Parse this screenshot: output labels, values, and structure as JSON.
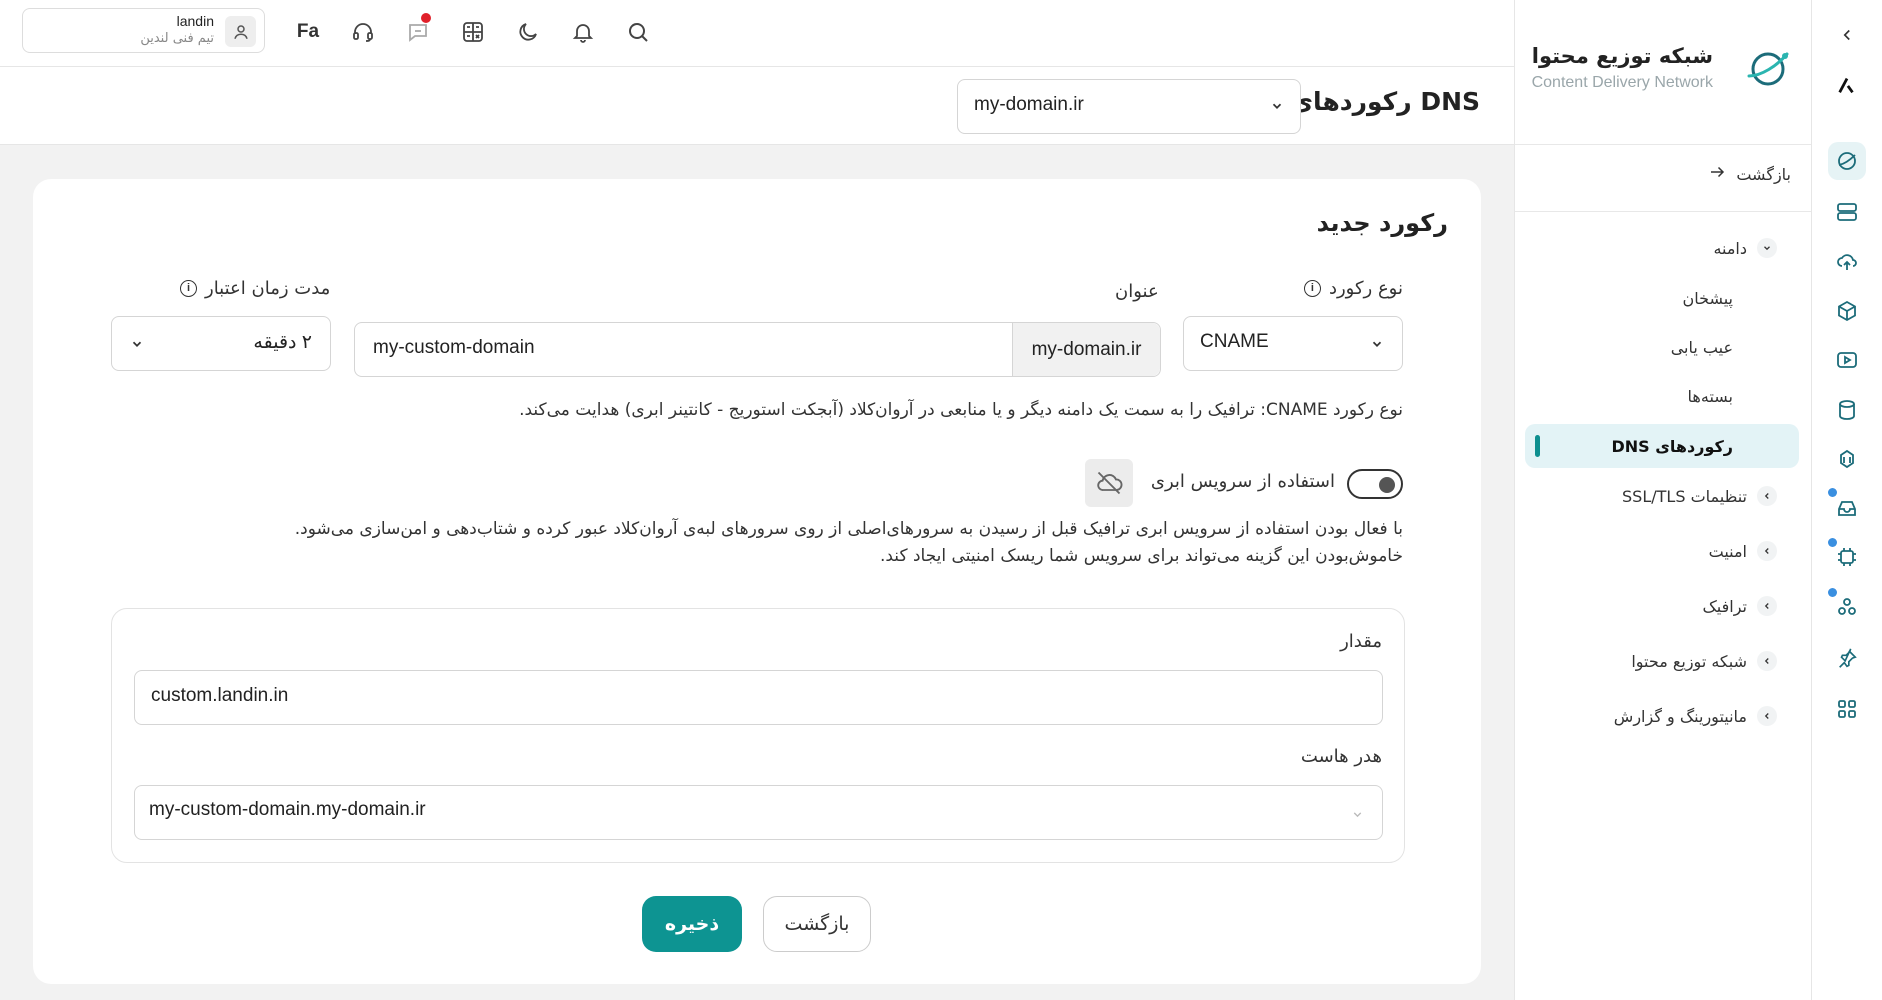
{
  "brand": {
    "name": "شبکه توزیع محتوا",
    "subtitle": "Content Delivery Network"
  },
  "header": {
    "user": {
      "name": "landin",
      "role": "تیم فنی لندین"
    },
    "language": "Fa",
    "icons": [
      "search-icon",
      "bell-icon",
      "moon-icon",
      "calculator-icon",
      "chat-icon",
      "headset-icon"
    ]
  },
  "subheader": {
    "title": "رکوردهای DNS",
    "domain_select": "my-domain.ir"
  },
  "sidebar": {
    "back": "بازگشت",
    "items": [
      {
        "label": "دامنه",
        "expanded": true
      },
      {
        "label": "پیشخان",
        "sub": true
      },
      {
        "label": "عیب یابی",
        "sub": true
      },
      {
        "label": "بسته‌ها",
        "sub": true
      },
      {
        "label": "رکوردهای DNS",
        "sub": true,
        "active": true
      },
      {
        "label": "تنظیمات SSL/TLS"
      },
      {
        "label": "امنیت"
      },
      {
        "label": "ترافیک"
      },
      {
        "label": "شبکه توزیع محتوا"
      },
      {
        "label": "مانیتورینگ و گزارش"
      }
    ]
  },
  "form": {
    "title": "رکورد جدید",
    "record_type_label": "نوع رکورد",
    "record_type_value": "CNAME",
    "name_label": "عنوان",
    "name_prefix": "my-domain.ir",
    "name_value": "my-custom-domain",
    "ttl_label": "مدت زمان اعتبار",
    "ttl_value": "۲ دقیقه",
    "type_description": "نوع رکورد CNAME: ترافیک را به سمت یک دامنه دیگر و یا منابعی در آروان‌کلاد (آبجکت استوریج - کانتینر ابری) هدایت می‌کند.",
    "cloud_label": "استفاده از سرویس ابری",
    "cloud_desc_1": "با فعال بودن استفاده از سرویس ابری ترافیک قبل از رسیدن به سرورهای‌اصلی از روی سرورهای لبه‌ی آروان‌کلاد عبور کرده و شتاب‌دهی و امن‌سازی می‌شود.",
    "cloud_desc_2": "خاموش‌بودن این گزینه می‌تواند برای سرویس شما ریسک امنیتی ایجاد کند.",
    "value_label": "مقدار",
    "value_value": "custom.landin.in",
    "host_header_label": "هدر هاست",
    "host_header_value": "my-custom-domain.my-domain.ir",
    "save_label": "ذخیره",
    "back_label": "بازگشت"
  },
  "colors": {
    "accent": "#0d9492",
    "active_bg": "#e3f3f6",
    "notification": "#e0202a",
    "rail_dot": "#3a8fe0"
  }
}
